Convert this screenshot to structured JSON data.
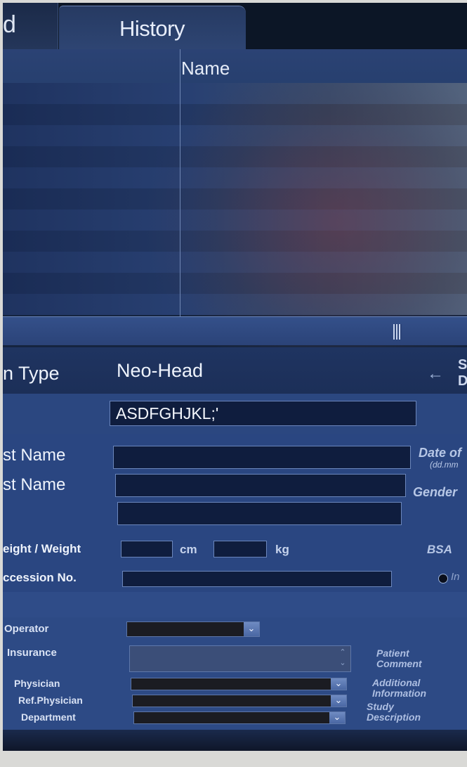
{
  "tabs": {
    "partial_left": "d",
    "history": "History"
  },
  "list": {
    "column_name": "Name",
    "row_count": 11
  },
  "form": {
    "exam_type_label": "n Type",
    "exam_type_value": "Neo-Head",
    "side_button_text": [
      "S",
      "D"
    ],
    "patient_id_value": "ASDFGHJKL;'",
    "first_name_label": "st Name",
    "last_name_label": "st Name",
    "middle_label": "",
    "date_label": "Date of",
    "date_hint": "(dd.mm",
    "gender_label": "Gender",
    "height_weight_label": "eight / Weight",
    "cm_unit": "cm",
    "kg_unit": "kg",
    "bsa_label": "BSA",
    "accession_label": "ccession No.",
    "in_label": "In",
    "operator_label": "Operator",
    "insurance_label": "Insurance",
    "physician_label": "Physician",
    "ref_physician_label": "Ref.Physician",
    "department_label": "Department",
    "patient_comment_label": [
      "Patient",
      "Comment"
    ],
    "additional_info_label": [
      "Additional",
      "Information"
    ],
    "study_description_label": [
      "Study",
      "Description"
    ]
  }
}
